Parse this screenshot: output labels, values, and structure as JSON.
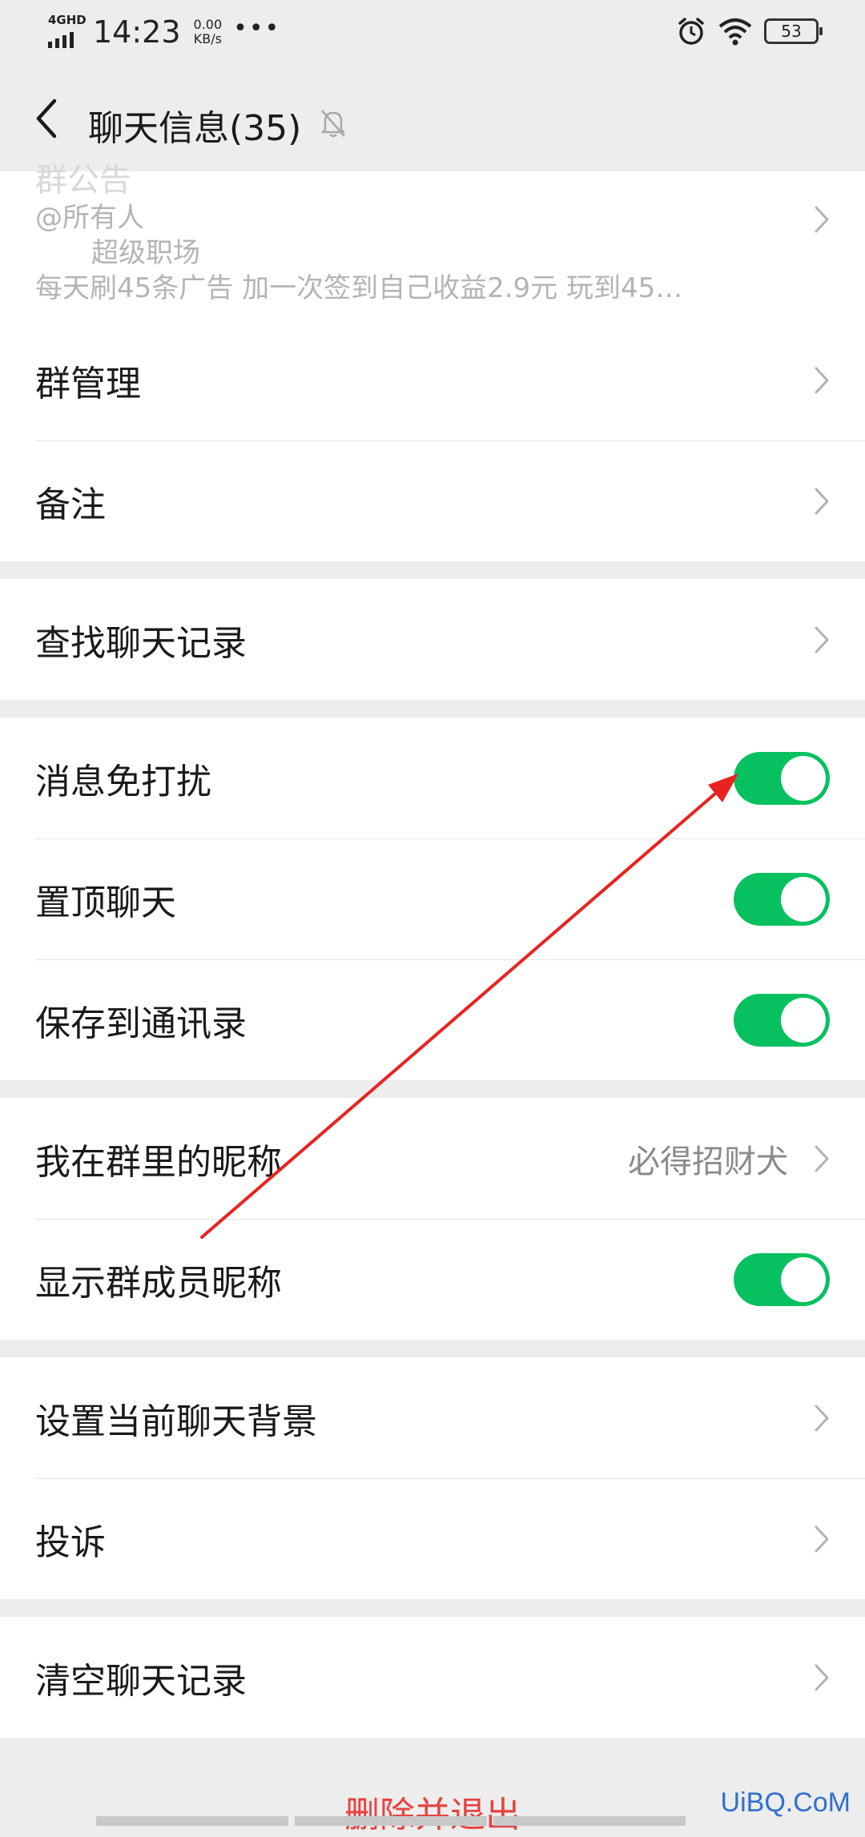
{
  "status_bar": {
    "network": "4GHD",
    "time": "14:23",
    "speed_value": "0.00",
    "speed_unit": "KB/s",
    "more": "•••",
    "battery": "53",
    "icons": [
      "signal-icon",
      "alarm-icon",
      "wifi-icon",
      "battery-icon"
    ]
  },
  "nav": {
    "title": "聊天信息(35)",
    "icons": [
      "back-icon",
      "mute-bell-icon"
    ]
  },
  "announcement": {
    "line1": "@所有人",
    "line2": "超级职场",
    "line3": "每天刷45条广告 加一次签到自己收益2.9元 玩到45…"
  },
  "group_manage": {
    "label": "群管理"
  },
  "remark": {
    "label": "备注"
  },
  "search_history": {
    "label": "查找聊天记录"
  },
  "mute": {
    "label": "消息免打扰",
    "on": true
  },
  "pin": {
    "label": "置顶聊天",
    "on": true
  },
  "save_contacts": {
    "label": "保存到通讯录",
    "on": true
  },
  "my_nickname": {
    "label": "我在群里的昵称",
    "value": "必得招财犬"
  },
  "show_nicknames": {
    "label": "显示群成员昵称",
    "on": true
  },
  "background": {
    "label": "设置当前聊天背景"
  },
  "complain": {
    "label": "投诉"
  },
  "clear_history": {
    "label": "清空聊天记录"
  },
  "delete_exit": {
    "label": "删除并退出"
  },
  "watermark": "UiBQ.CoM",
  "colors": {
    "toggle_on": "#07c160",
    "danger": "#e64340",
    "arrow": "#e8231f",
    "background": "#ededed"
  }
}
